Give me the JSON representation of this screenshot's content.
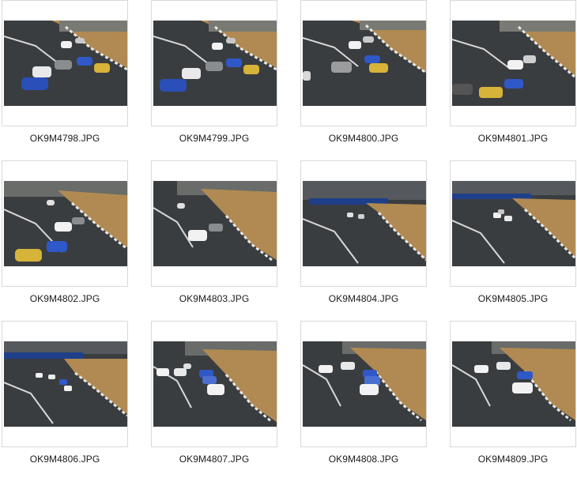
{
  "files": [
    {
      "name": "OK9M4798.JPG",
      "icon": "race-photo-thumbnail"
    },
    {
      "name": "OK9M4799.JPG",
      "icon": "race-photo-thumbnail"
    },
    {
      "name": "OK9M4800.JPG",
      "icon": "race-photo-thumbnail"
    },
    {
      "name": "OK9M4801.JPG",
      "icon": "race-photo-thumbnail"
    },
    {
      "name": "OK9M4802.JPG",
      "icon": "race-photo-thumbnail"
    },
    {
      "name": "OK9M4803.JPG",
      "icon": "race-photo-thumbnail"
    },
    {
      "name": "OK9M4804.JPG",
      "icon": "race-photo-thumbnail"
    },
    {
      "name": "OK9M4805.JPG",
      "icon": "race-photo-thumbnail"
    },
    {
      "name": "OK9M4806.JPG",
      "icon": "race-photo-thumbnail"
    },
    {
      "name": "OK9M4807.JPG",
      "icon": "race-photo-thumbnail"
    },
    {
      "name": "OK9M4808.JPG",
      "icon": "race-photo-thumbnail"
    },
    {
      "name": "OK9M4809.JPG",
      "icon": "race-photo-thumbnail"
    }
  ],
  "colors": {
    "asphalt": "#3a3d40",
    "grass": "#b08a52",
    "curb_red": "#c0443c",
    "curb_white": "#e8e8e8",
    "banner": "#1f3f8a",
    "border": "#d9d9d9"
  }
}
